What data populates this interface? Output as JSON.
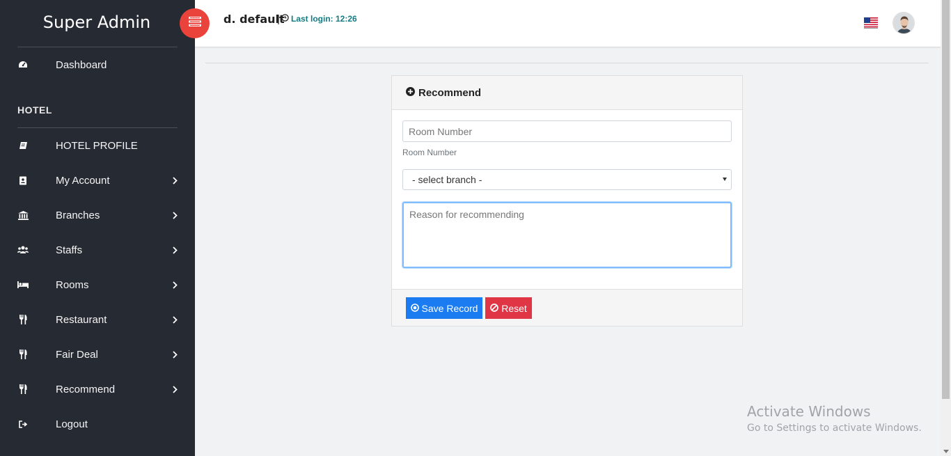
{
  "sidebar": {
    "brand": "Super Admin",
    "section": "HOTEL",
    "items": [
      {
        "label": "Dashboard",
        "icon": "dashboard-icon"
      },
      {
        "label": "HOTEL PROFILE",
        "icon": "book-icon"
      },
      {
        "label": "My Account",
        "icon": "address-book-icon"
      },
      {
        "label": "Branches",
        "icon": "bank-icon"
      },
      {
        "label": "Staffs",
        "icon": "users-icon"
      },
      {
        "label": "Rooms",
        "icon": "bed-icon"
      },
      {
        "label": "Restaurant",
        "icon": "cutlery-icon"
      },
      {
        "label": "Fair Deal",
        "icon": "cutlery-icon"
      },
      {
        "label": "Recommend",
        "icon": "cutlery-icon"
      },
      {
        "label": "Logout",
        "icon": "sign-out-icon"
      }
    ]
  },
  "topbar": {
    "user": "d. default",
    "separator": "|",
    "last_login": "Last login: 12:26",
    "flag_icon": "us-flag-icon",
    "avatar_icon": "user-avatar"
  },
  "form": {
    "title": "Recommend",
    "room_placeholder": "Room Number",
    "room_help": "Room Number",
    "branch_selected": "- select branch -",
    "reason_placeholder": "Reason for recommending",
    "save_label": "Save Record",
    "reset_label": "Reset"
  },
  "watermark": {
    "line1": "Activate Windows",
    "line2": "Go to Settings to activate Windows."
  },
  "colors": {
    "sidebar_bg": "#262a33",
    "toggle_bg": "#e9433b",
    "last_login": "#127c82",
    "save_btn": "#1a7cf0",
    "reset_btn": "#e03545"
  }
}
